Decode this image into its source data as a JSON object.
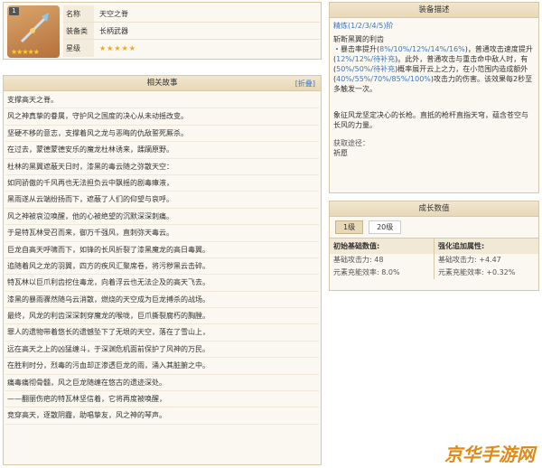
{
  "card": {
    "badge": "1",
    "rows": [
      {
        "key": "名称",
        "value": "天空之脊"
      },
      {
        "key": "装备类型",
        "value": "长柄武器"
      },
      {
        "key": "星级",
        "value": "★★★★★"
      }
    ],
    "rarity_stars": "★★★★★"
  },
  "story": {
    "title": "相关故事",
    "fold_label": "[折叠]",
    "lines": [
      "支撑高天之脊。",
      "风之神真挚的眷属，守护风之国度的决心从未动摇改变。",
      "坚硬不移的意志，支撑着风之龙与恶晦的仇敌誓死厮杀。",
      "在过去，蒙德蒙德安乐的魔龙杜林诱来，蹂躏原野。",
      "杜林的黑翼遮蔽天日时，漆黑的毒云随之弥散天空：",
      "如同骄傲的千风再也无法担负云中飘摇的剧毒瘴液，",
      "黑雨遂从云端纷扬而下，遮蔽了人们的仰望与哀呼。",
      "风之神被哀泣唤醒，他的心被绝望的沉默深深刺痛。",
      "于是特瓦林受召而来，御万千强风，直刺弥天毒云。",
      "巨龙自高天呼啸而下，如锋的长风折裂了漆黑魔龙的高日毒翼。",
      "追随着风之龙的羽翼，四方的疾风汇聚席卷，将污秽黑云击碎。",
      "特瓦林以巨爪利齿挖住毒龙，向着浮云也无法企及的高天飞去。",
      "漆黑的暴雨骤然随乌云消散，燃烧的天空成为巨龙搏杀的战场。",
      "最终，风龙的利齿深深刺穿魔龙的喉咙，巨爪撕裂腐朽的胸膛。",
      "罪人的遗物带着悠长的遗憾坠下了无垠的天空，落在了雪山上，",
      "远在高天之上的凶猛缠斗，于深渊危机面前保护了风神的万民。",
      "在胜利时分，烈毒的污血却正渗透巨龙的雨，涌入其脏腑之中。",
      "痛毒痛彻骨髓，风之巨龙随缠在悠古的遗迹深处。",
      "——翻丽伤疤的特瓦林坚信着，它将再度被唤醒，",
      "竞穿高天，逐散阴霾，助唱挚友，风之神的琴声。"
    ]
  },
  "desc": {
    "title": "装备描述",
    "refine": "精炼(1/2/3/4/5)阶",
    "skill_title": "斩断黑翼的利齿",
    "p1_a": "・暴击率提升(",
    "p1_hl1": "8%/10%/12%/14%/16%",
    "p1_b": ")，普通攻击速度提升(",
    "p1_hl2": "12%/12%/待补充",
    "p1_c": ")。此外，普通攻击与重击命中敌人时，有(",
    "p1_hl3": "50%/50%/待补充",
    "p1_d": ")概率展开云上之力，在小范围内造成额外(",
    "p1_hl4": "40%/55%/70%/85%/100%",
    "p1_e": ")攻击力的伤害。该效果每2秒至多触发一次。",
    "lore": "象征风龙坚定决心的长枪。直抵的枪杆直指天穹，蕴含苍空与长风的力量。",
    "source_label": "获取途径：",
    "source_value": "祈愿"
  },
  "growth": {
    "title": "成长数值",
    "tabs": [
      "1级",
      "20级"
    ],
    "left": {
      "head": "初始基础数值:",
      "rows": [
        "基础攻击力: 48",
        "元素充能效率: 8.0%"
      ]
    },
    "right": {
      "head": "强化追加属性:",
      "rows": [
        "基础攻击力: +4.47",
        "元素充能效率: +0.32%"
      ]
    }
  },
  "watermark": "京华手游网"
}
